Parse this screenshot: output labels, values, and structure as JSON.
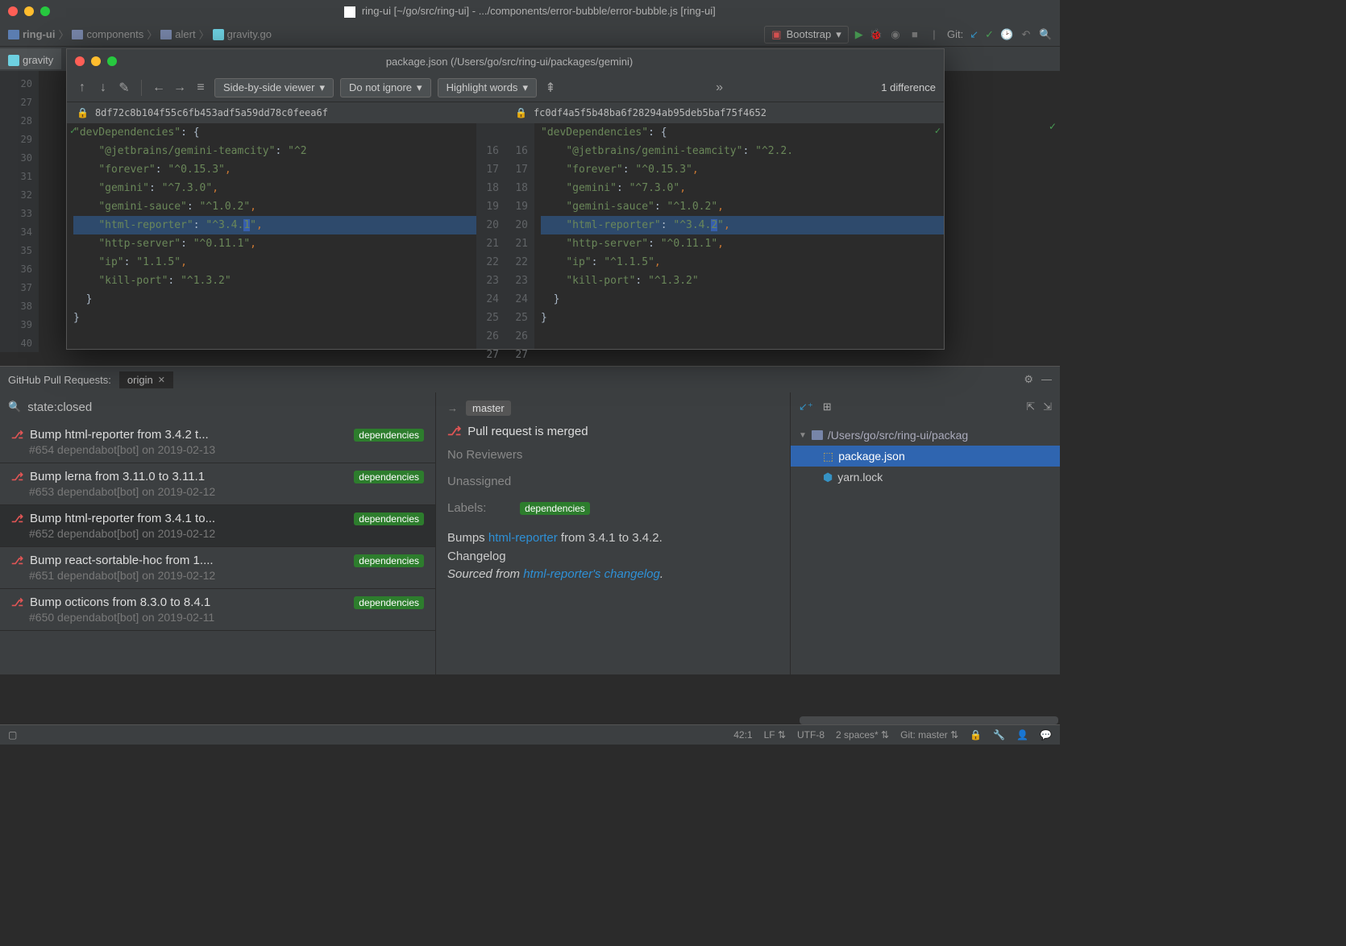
{
  "window": {
    "title": "ring-ui [~/go/src/ring-ui] - .../components/error-bubble/error-bubble.js [ring-ui]"
  },
  "breadcrumbs": [
    "ring-ui",
    "components",
    "alert",
    "gravity.go"
  ],
  "run_config": "Bootstrap",
  "git_label": "Git:",
  "editor": {
    "tab": "gravity",
    "gutter_lines": [
      "20",
      "27",
      "28",
      "29",
      "30",
      "31",
      "32",
      "33",
      "34",
      "35",
      "36",
      "37",
      "38",
      "39",
      "40"
    ]
  },
  "diff": {
    "title": "package.json (/Users/go/src/ring-ui/packages/gemini)",
    "viewer_mode": "Side-by-side viewer",
    "ignore_mode": "Do not ignore",
    "highlight_mode": "Highlight words",
    "count": "1 difference",
    "left_hash": "8df72c8b104f55c6fb453adf5a59dd78c0feea6f",
    "right_hash": "fc0df4a5f5b48ba6f28294ab95deb5baf75f4652",
    "left_gutter": [
      "",
      "16",
      "17",
      "18",
      "19",
      "20",
      "21",
      "22",
      "23",
      "24",
      "25",
      "26",
      "27"
    ],
    "right_gutter": [
      "",
      "16",
      "17",
      "18",
      "19",
      "20",
      "21",
      "22",
      "23",
      "24",
      "25",
      "26",
      "27"
    ],
    "left_code": [
      {
        "key": "\"devDependencies\"",
        "punc": ": {"
      },
      {
        "indent": "    ",
        "key": "\"@jetbrains/gemini-teamcity\"",
        "mid": ": ",
        "val": "\"^2",
        "end": ""
      },
      {
        "indent": "    ",
        "key": "\"forever\"",
        "mid": ": ",
        "val": "\"^0.15.3\"",
        "end": ","
      },
      {
        "indent": "    ",
        "key": "\"gemini\"",
        "mid": ": ",
        "val": "\"^7.3.0\"",
        "end": ","
      },
      {
        "indent": "    ",
        "key": "\"gemini-sauce\"",
        "mid": ": ",
        "val": "\"^1.0.2\"",
        "end": ","
      },
      {
        "indent": "    ",
        "key": "\"html-reporter\"",
        "mid": ": ",
        "val_pre": "\"^3.4.",
        "hl": "1",
        "val_post": "\"",
        "end": ",",
        "highlight": true
      },
      {
        "indent": "    ",
        "key": "\"http-server\"",
        "mid": ": ",
        "val": "\"^0.11.1\"",
        "end": ","
      },
      {
        "indent": "    ",
        "key": "\"ip\"",
        "mid": ": ",
        "val": "\"1.1.5\"",
        "end": ","
      },
      {
        "indent": "    ",
        "key": "\"kill-port\"",
        "mid": ": ",
        "val": "\"^1.3.2\"",
        "end": ""
      },
      {
        "raw": "  }"
      },
      {
        "raw": "}"
      }
    ],
    "right_code": [
      {
        "key": "\"devDependencies\"",
        "punc": ": {"
      },
      {
        "indent": "    ",
        "key": "\"@jetbrains/gemini-teamcity\"",
        "mid": ": ",
        "val": "\"^2.2.",
        "end": ""
      },
      {
        "indent": "    ",
        "key": "\"forever\"",
        "mid": ": ",
        "val": "\"^0.15.3\"",
        "end": ","
      },
      {
        "indent": "    ",
        "key": "\"gemini\"",
        "mid": ": ",
        "val": "\"^7.3.0\"",
        "end": ","
      },
      {
        "indent": "    ",
        "key": "\"gemini-sauce\"",
        "mid": ": ",
        "val": "\"^1.0.2\"",
        "end": ","
      },
      {
        "indent": "    ",
        "key": "\"html-reporter\"",
        "mid": ": ",
        "val_pre": "\"^3.4.",
        "hl": "2",
        "val_post": "\"",
        "end": ",",
        "highlight": true
      },
      {
        "indent": "    ",
        "key": "\"http-server\"",
        "mid": ": ",
        "val": "\"^0.11.1\"",
        "end": ","
      },
      {
        "indent": "    ",
        "key": "\"ip\"",
        "mid": ": ",
        "val": "\"^1.1.5\"",
        "end": ","
      },
      {
        "indent": "    ",
        "key": "\"kill-port\"",
        "mid": ": ",
        "val": "\"^1.3.2\"",
        "end": ""
      },
      {
        "raw": "  }"
      },
      {
        "raw": "}"
      }
    ]
  },
  "pr_panel": {
    "title": "GitHub Pull Requests:",
    "origin_tab": "origin",
    "search": "state:closed",
    "target_branch": "master",
    "status": "Pull request is merged",
    "reviewers": "No Reviewers",
    "assignees": "Unassigned",
    "labels_label": "Labels:",
    "dep_badge": "dependencies",
    "body_prefix": "Bumps ",
    "body_link1": "html-reporter",
    "body_suffix": " from 3.4.1 to 3.4.2.",
    "changelog": "Changelog",
    "sourced": "Sourced from ",
    "body_link2": "html-reporter's changelog",
    "dot": ".",
    "items": [
      {
        "title": "Bump html-reporter from 3.4.2 t...",
        "sub": "#654 dependabot[bot] on 2019-02-13",
        "selected": false
      },
      {
        "title": "Bump lerna from 3.11.0 to 3.11.1",
        "sub": "#653 dependabot[bot] on 2019-02-12",
        "selected": false
      },
      {
        "title": "Bump html-reporter from 3.4.1 to...",
        "sub": "#652 dependabot[bot] on 2019-02-12",
        "selected": true
      },
      {
        "title": "Bump react-sortable-hoc from 1....",
        "sub": "#651 dependabot[bot] on 2019-02-12",
        "selected": false
      },
      {
        "title": "Bump octicons from 8.3.0 to 8.4.1",
        "sub": "#650 dependabot[bot] on 2019-02-11",
        "selected": false
      }
    ],
    "files": {
      "root": "/Users/go/src/ring-ui/packag",
      "items": [
        "package.json",
        "yarn.lock"
      ]
    }
  },
  "status": {
    "pos": "42:1",
    "line_ending": "LF",
    "encoding": "UTF-8",
    "indent": "2 spaces*",
    "git_branch": "Git: master"
  }
}
